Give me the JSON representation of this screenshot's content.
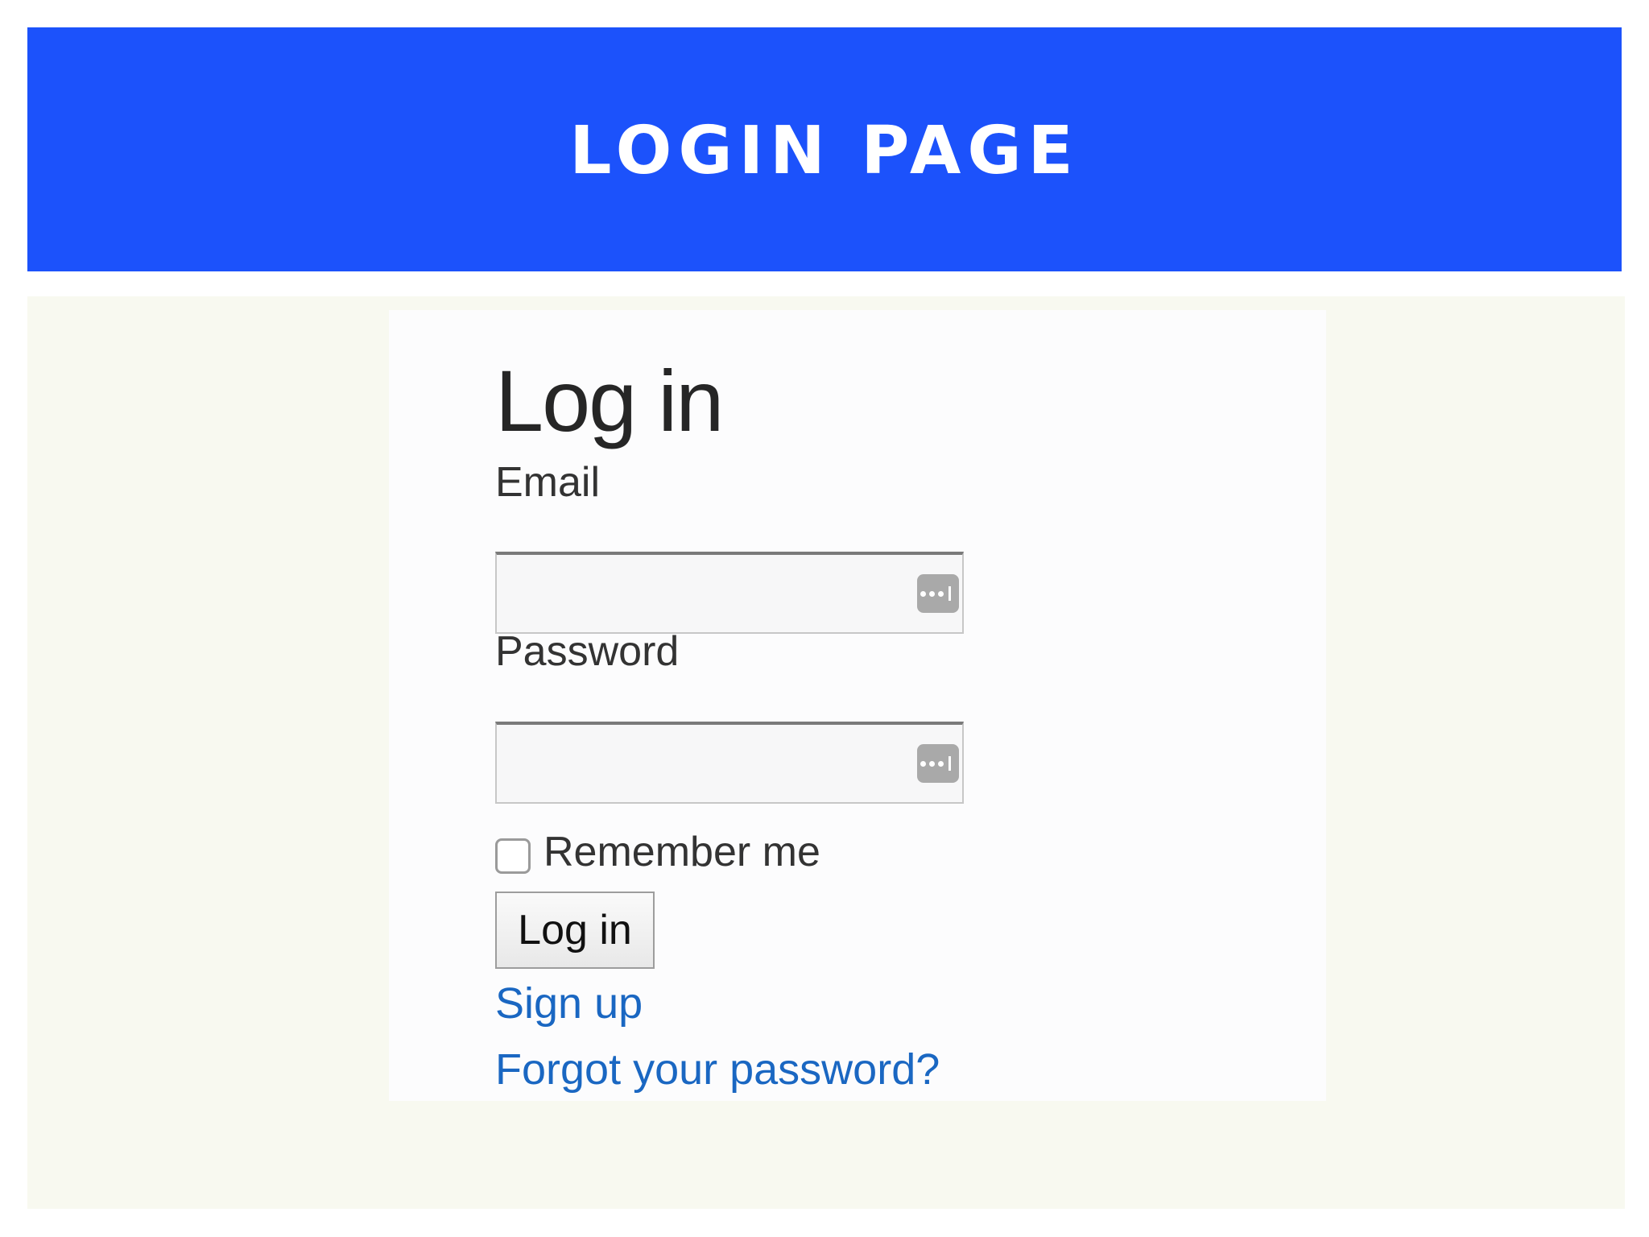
{
  "colors": {
    "banner_bg": "#1c52fb",
    "banner_text": "#ffffff",
    "stage_bg": "#f8f9f0",
    "card_bg": "#fcfcfd",
    "link": "#1a67c2"
  },
  "banner": {
    "title": "LOGIN PAGE"
  },
  "form": {
    "heading": "Log in",
    "email": {
      "label": "Email",
      "value": "",
      "icon": "password-manager-icon"
    },
    "password": {
      "label": "Password",
      "value": "",
      "icon": "password-manager-icon"
    },
    "remember": {
      "label": "Remember me",
      "checked": false
    },
    "submit_label": "Log in",
    "signup_link": "Sign up",
    "forgot_link": "Forgot your password?"
  }
}
